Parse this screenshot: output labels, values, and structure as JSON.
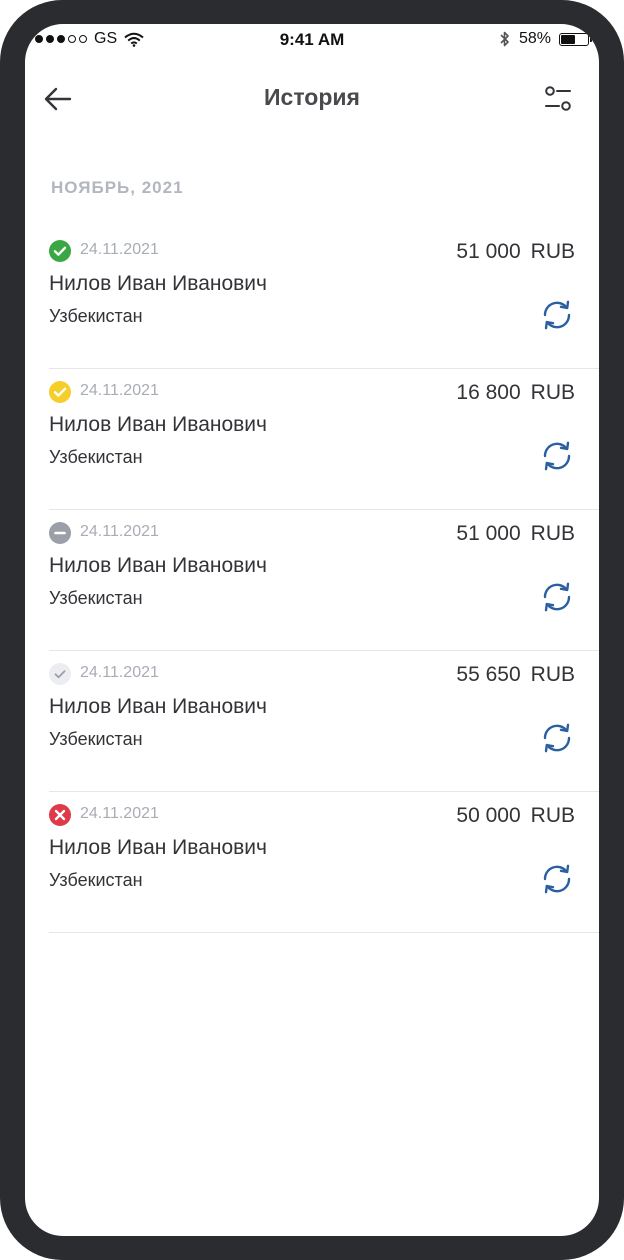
{
  "status_bar": {
    "carrier": "GS",
    "time": "9:41 AM",
    "battery": "58%",
    "battery_level": 0.58,
    "signal_dots": [
      true,
      true,
      true,
      false,
      false
    ]
  },
  "nav": {
    "title": "История",
    "back_icon": "arrow-left-icon",
    "filter_icon": "filter-icon"
  },
  "section": {
    "title": "НОЯБРЬ, 2021"
  },
  "colors": {
    "success": "#3aa745",
    "pending": "#f5ce2a",
    "cancelled": "#9c9ea8",
    "draft": "#ecedf1",
    "error": "#de3a48",
    "repeat": "#2a5fa0"
  },
  "transactions": [
    {
      "status": "success",
      "date": "24.11.2021",
      "name": "Нилов Иван Иванович",
      "country": "Узбекистан",
      "amount": "51 000",
      "currency": "RUB"
    },
    {
      "status": "pending",
      "date": "24.11.2021",
      "name": "Нилов Иван Иванович",
      "country": "Узбекистан",
      "amount": "16 800",
      "currency": "RUB"
    },
    {
      "status": "cancelled",
      "date": "24.11.2021",
      "name": "Нилов Иван Иванович",
      "country": "Узбекистан",
      "amount": "51 000",
      "currency": "RUB"
    },
    {
      "status": "draft",
      "date": "24.11.2021",
      "name": "Нилов Иван Иванович",
      "country": "Узбекистан",
      "amount": "55 650",
      "currency": "RUB"
    },
    {
      "status": "error",
      "date": "24.11.2021",
      "name": "Нилов Иван Иванович",
      "country": "Узбекистан",
      "amount": "50 000",
      "currency": "RUB"
    }
  ]
}
